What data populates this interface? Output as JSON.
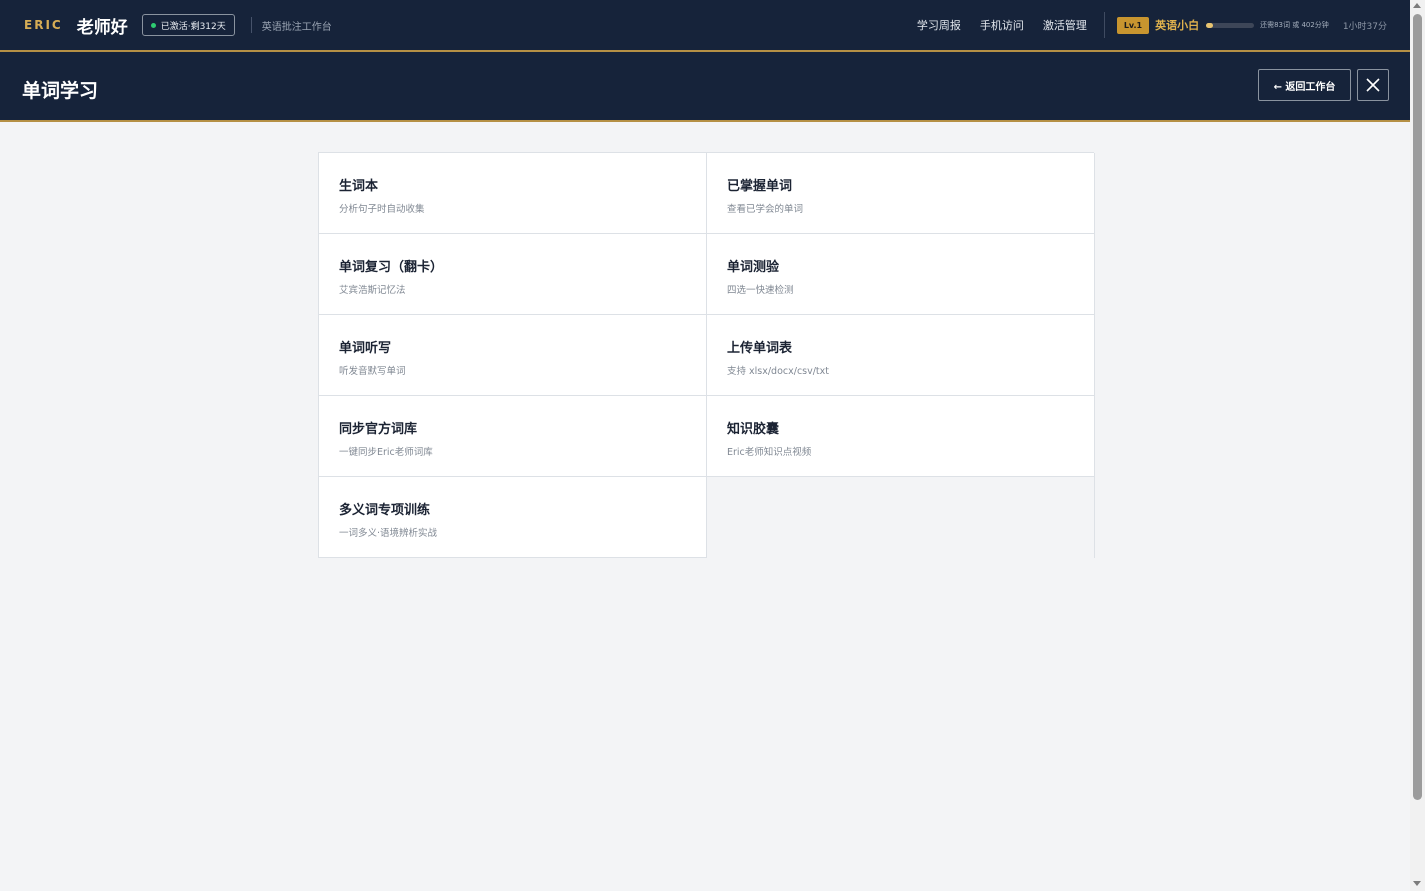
{
  "topbar": {
    "brand": "ERIC",
    "app_name": "老师好",
    "status_badge": "已激活·剩312天",
    "workspace_label": "英语批注工作台",
    "nav": [
      "学习周报",
      "手机访问",
      "激活管理"
    ],
    "level_badge": "Lv.1",
    "level_name": "英语小白",
    "level_progress": 0.15,
    "progress_text": "还需83词 或 402分钟",
    "study_time": "1小时37分",
    "status_dot_color": "#2ecc71",
    "accent_color": "#d6ac55"
  },
  "header": {
    "title": "单词学习",
    "back_label": "← 返回工作台",
    "close_icon": "close-icon"
  },
  "cards": [
    {
      "title": "生词本",
      "desc": "分析句子时自动收集"
    },
    {
      "title": "已掌握单词",
      "desc": "查看已学会的单词"
    },
    {
      "title": "单词复习（翻卡）",
      "desc": "艾宾浩斯记忆法"
    },
    {
      "title": "单词测验",
      "desc": "四选一快速检测"
    },
    {
      "title": "单词听写",
      "desc": "听发音默写单词"
    },
    {
      "title": "上传单词表",
      "desc": "支持 xlsx/docx/csv/txt"
    },
    {
      "title": "同步官方词库",
      "desc": "一键同步Eric老师词库"
    },
    {
      "title": "知识胶囊",
      "desc": "Eric老师知识点视频"
    },
    {
      "title": "多义词专项训练",
      "desc": "一词多义·语境辨析实战"
    }
  ]
}
